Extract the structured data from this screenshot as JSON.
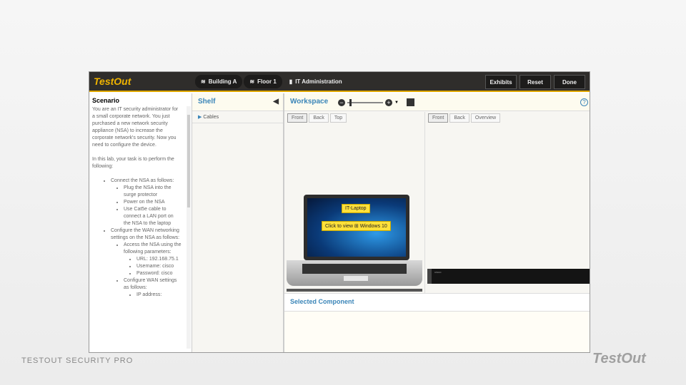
{
  "header": {
    "logo": "TestOut",
    "breadcrumbs": [
      "Building A",
      "Floor 1",
      "IT Administration"
    ],
    "buttons": [
      "Exhibits",
      "Reset",
      "Done"
    ]
  },
  "scenario": {
    "title": "Scenario",
    "intro": "You are an IT security administrator for a small corporate network. You just purchased a new network security appliance (NSA) to increase the corporate network's security. Now you need to configure the device.",
    "task": "In this lab, your task is to perform the following:",
    "items": [
      {
        "text": "Connect the NSA as follows:",
        "sub": [
          "Plug the NSA into the surge protector",
          "Power on the NSA",
          "Use Cat5e cable to connect a LAN port on the NSA to the laptop"
        ]
      },
      {
        "text": "Configure the WAN networking settings on the NSA as follows:",
        "sub": [
          "Access the NSA using the following parameters:"
        ],
        "subsub": [
          "URL: 192.168.75.1",
          "Username: cisco",
          "Password: cisco"
        ],
        "sub2": "Configure WAN settings as follows:",
        "subsub2": [
          "IP address:"
        ]
      }
    ]
  },
  "shelf": {
    "title": "Shelf",
    "items": [
      "Cables"
    ]
  },
  "workspace": {
    "title": "Workspace",
    "left_views": [
      "Front",
      "Back",
      "Top"
    ],
    "right_views": [
      "Front",
      "Back",
      "Overview"
    ],
    "laptop_label": "IT-Laptop",
    "laptop_action": "Click to view",
    "laptop_os": "Windows 10",
    "help": "?"
  },
  "selected": {
    "title": "Selected Component"
  },
  "footer": {
    "text": "TESTOUT SECURITY PRO",
    "logo": "TestOut"
  }
}
